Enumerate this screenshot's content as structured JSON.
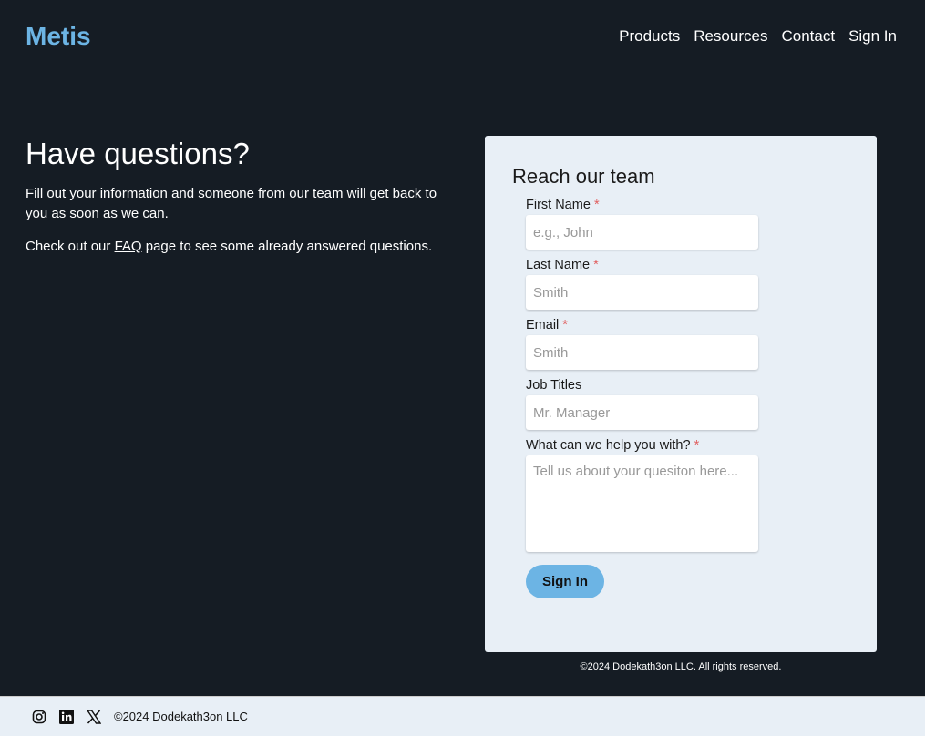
{
  "brand": "Metis",
  "nav": [
    "Products",
    "Resources",
    "Contact",
    "Sign In"
  ],
  "hero": {
    "title": "Have questions?",
    "p1": "Fill out your information and someone from our team will get back to you as soon as we can.",
    "p2_before": "Check out our ",
    "p2_link": "FAQ",
    "p2_after": " page to see some already answered questions."
  },
  "form": {
    "title": "Reach our team",
    "first_label": "First Name",
    "first_ph": "e.g., John",
    "last_label": "Last Name",
    "last_ph": "Smith",
    "email_label": "Email",
    "email_ph": "Smith",
    "job_label": "Job Titles",
    "job_ph": "Mr. Manager",
    "msg_label": "What can we help you with?",
    "msg_ph": "Tell us about your quesiton here...",
    "req": "*",
    "submit": "Sign In"
  },
  "rights": "©2024 Dodekath3on LLC. All rights reserved.",
  "footer": {
    "copyright": "©2024 Dodekath3on LLC"
  }
}
